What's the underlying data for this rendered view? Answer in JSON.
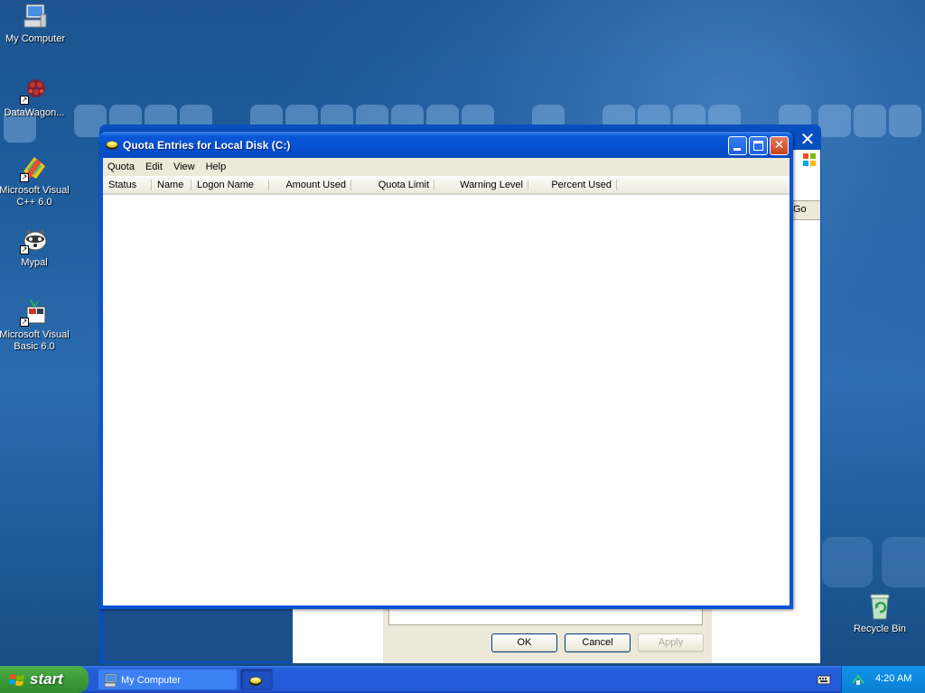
{
  "desktop": {
    "icons": [
      {
        "label": "My Computer",
        "icon": "my-computer-icon"
      },
      {
        "label": "DataWagon...",
        "icon": "datawagon-icon"
      },
      {
        "label": "Microsoft Visual C++ 6.0",
        "icon": "visual-cpp-icon"
      },
      {
        "label": "Mypal",
        "icon": "mypal-icon"
      },
      {
        "label": "Microsoft Visual Basic 6.0",
        "icon": "visual-basic-icon"
      },
      {
        "label": "Recycle Bin",
        "icon": "recycle-bin-icon"
      }
    ]
  },
  "background_dialog": {
    "go_label": "Go",
    "buttons": {
      "ok": "OK",
      "cancel": "Cancel",
      "apply": "Apply"
    }
  },
  "quota_window": {
    "title": "Quota Entries for Local Disk (C:)",
    "menu": [
      "Quota",
      "Edit",
      "View",
      "Help"
    ],
    "columns": [
      "Status",
      "Name",
      "Logon Name",
      "Amount Used",
      "Quota Limit",
      "Warning Level",
      "Percent Used"
    ],
    "rows": []
  },
  "taskbar": {
    "start_label": "start",
    "items": [
      {
        "label": "My Computer",
        "icon": "my-computer-icon"
      },
      {
        "label": "",
        "icon": "quota-icon"
      }
    ],
    "clock": "4:20 AM"
  },
  "colors": {
    "title_bar": "#0a55d6",
    "taskbar": "#245edc",
    "start_button": "#3c9c38",
    "close_button": "#c8421c"
  }
}
